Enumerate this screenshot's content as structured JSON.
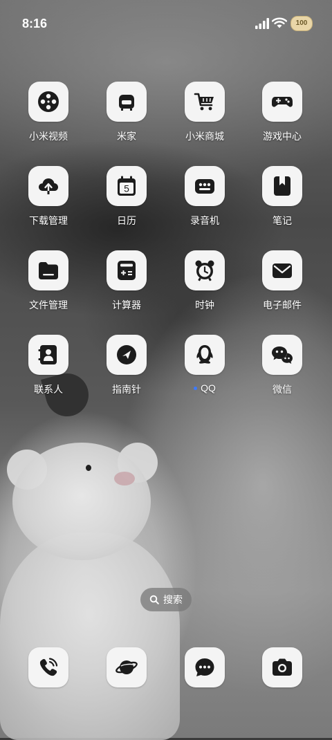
{
  "status_bar": {
    "time": "8:16",
    "battery": "100"
  },
  "apps": [
    {
      "label": "小米视频",
      "icon": "film-reel-icon"
    },
    {
      "label": "米家",
      "icon": "sofa-icon"
    },
    {
      "label": "小米商城",
      "icon": "shopping-cart-icon"
    },
    {
      "label": "游戏中心",
      "icon": "gamepad-icon"
    },
    {
      "label": "下载管理",
      "icon": "cloud-download-icon"
    },
    {
      "label": "日历",
      "icon": "calendar-icon",
      "day": "5"
    },
    {
      "label": "录音机",
      "icon": "recorder-icon"
    },
    {
      "label": "笔记",
      "icon": "bookmark-note-icon"
    },
    {
      "label": "文件管理",
      "icon": "folder-icon"
    },
    {
      "label": "计算器",
      "icon": "calculator-icon"
    },
    {
      "label": "时钟",
      "icon": "alarm-clock-icon"
    },
    {
      "label": "电子邮件",
      "icon": "envelope-icon"
    },
    {
      "label": "联系人",
      "icon": "contact-card-icon"
    },
    {
      "label": "指南针",
      "icon": "compass-icon"
    },
    {
      "label": "QQ",
      "icon": "qq-penguin-icon",
      "new_dot": true
    },
    {
      "label": "微信",
      "icon": "wechat-bubbles-icon"
    }
  ],
  "search": {
    "label": "搜索",
    "icon": "search-icon"
  },
  "dock": [
    {
      "icon": "phone-icon"
    },
    {
      "icon": "planet-browser-icon"
    },
    {
      "icon": "message-bubble-icon"
    },
    {
      "icon": "camera-icon"
    }
  ],
  "colors": {
    "tile_bg": "#f4f4f4",
    "icon_fg": "#1c1c1c",
    "notify_dot": "#3d7bff"
  }
}
